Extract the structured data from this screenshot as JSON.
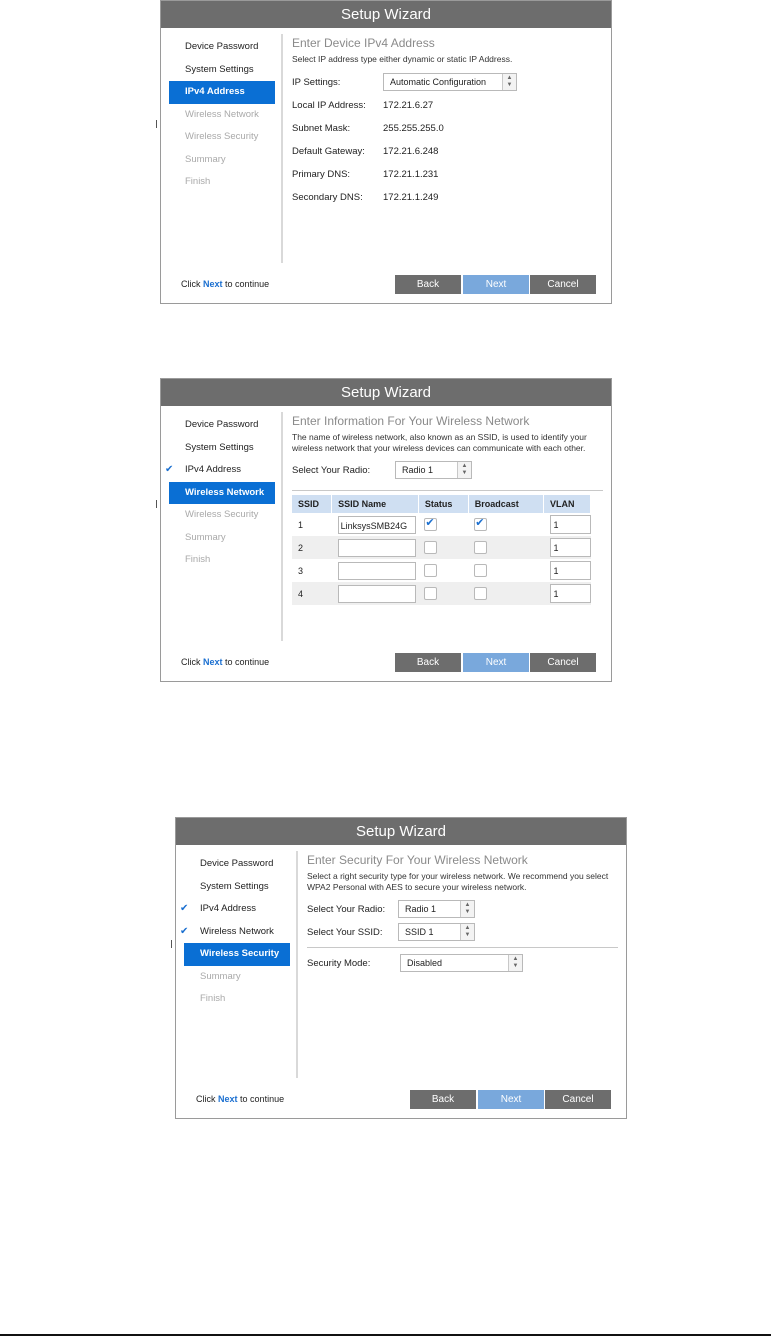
{
  "wizard_title": "Setup Wizard",
  "sidebar": {
    "device_password": "Device Password",
    "system_settings": "System Settings",
    "ipv4_address": "IPv4 Address",
    "wireless_network": "Wireless Network",
    "wireless_security": "Wireless Security",
    "summary": "Summary",
    "finish": "Finish"
  },
  "check_glyph": "✔",
  "footer": {
    "click": "Click",
    "next": "Next",
    "to_continue": "to continue"
  },
  "buttons": {
    "back": "Back",
    "next": "Next",
    "cancel": "Cancel"
  },
  "ipv4": {
    "heading": "Enter Device IPv4 Address",
    "description": "Select IP address type either dynamic or static IP Address.",
    "ip_settings_label": "IP Settings:",
    "ip_settings_value": "Automatic Configuration",
    "local_ip_label": "Local IP Address:",
    "local_ip_value": "172.21.6.27",
    "subnet_label": "Subnet Mask:",
    "subnet_value": "255.255.255.0",
    "gateway_label": "Default Gateway:",
    "gateway_value": "172.21.6.248",
    "primary_dns_label": "Primary DNS:",
    "primary_dns_value": "172.21.1.231",
    "secondary_dns_label": "Secondary DNS:",
    "secondary_dns_value": "172.21.1.249"
  },
  "wireless": {
    "heading": "Enter Information For Your Wireless Network",
    "description": "The name of wireless network, also known as an SSID, is used to identify your wireless network that your wireless devices can communicate with each other.",
    "radio_label": "Select Your Radio:",
    "radio_value": "Radio 1",
    "table_headers": [
      "SSID",
      "SSID Name",
      "Status",
      "Broadcast",
      "VLAN"
    ],
    "rows": [
      {
        "ssid": "1",
        "name": "LinksysSMB24G",
        "status": true,
        "broadcast": true,
        "vlan": "1"
      },
      {
        "ssid": "2",
        "name": "",
        "status": false,
        "broadcast": false,
        "vlan": "1"
      },
      {
        "ssid": "3",
        "name": "",
        "status": false,
        "broadcast": false,
        "vlan": "1"
      },
      {
        "ssid": "4",
        "name": "",
        "status": false,
        "broadcast": false,
        "vlan": "1"
      }
    ]
  },
  "security": {
    "heading": "Enter Security For Your Wireless Network",
    "description": "Select a right security type for your wireless network. We recommend you select WPA2 Personal with AES to secure your wireless network.",
    "radio_label": "Select Your Radio:",
    "radio_value": "Radio 1",
    "ssid_label": "Select Your SSID:",
    "ssid_value": "SSID 1",
    "mode_label": "Security Mode:",
    "mode_value": "Disabled"
  }
}
